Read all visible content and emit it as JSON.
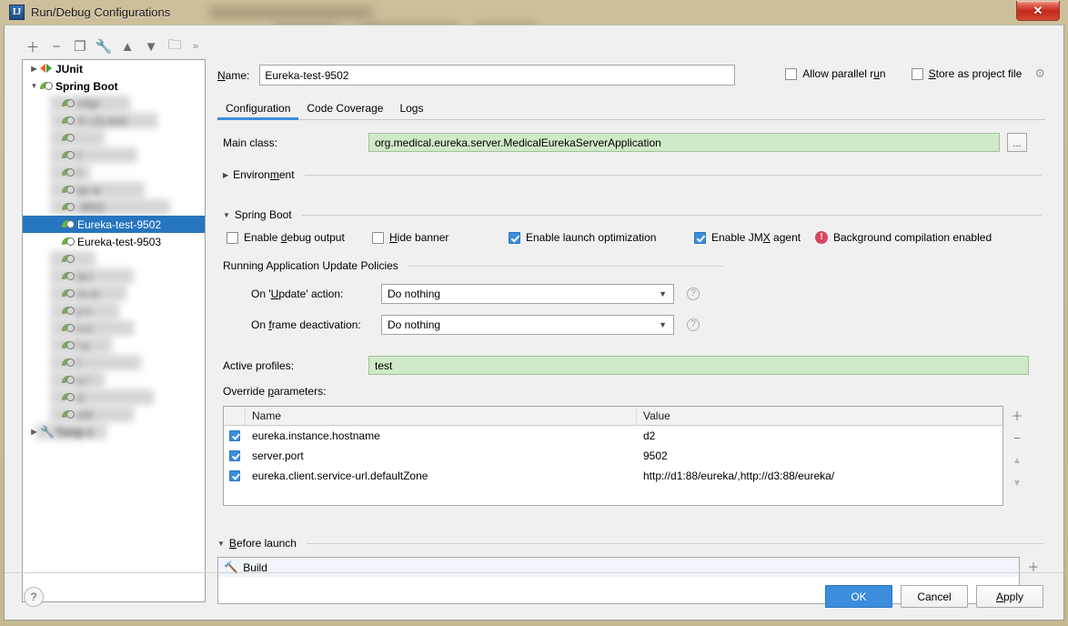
{
  "window": {
    "title": "Run/Debug Configurations",
    "app_icon": "intellij-idea-icon",
    "close_label": "✕"
  },
  "left_toolbar": {
    "buttons": [
      {
        "name": "add-configuration-button",
        "glyph": "＋"
      },
      {
        "name": "remove-configuration-button",
        "glyph": "−"
      },
      {
        "name": "copy-configuration-button",
        "glyph": "❐"
      },
      {
        "name": "edit-templates-button",
        "glyph": "🔧"
      },
      {
        "name": "move-up-button",
        "glyph": "▲"
      },
      {
        "name": "move-down-button",
        "glyph": "▼"
      },
      {
        "name": "move-into-folder-button",
        "glyph": "🗀"
      },
      {
        "name": "more-options-button",
        "glyph": "»"
      }
    ]
  },
  "tree": {
    "items": [
      {
        "label": "JUnit",
        "icon": "junit-icon",
        "level": 1,
        "twisty": "▶",
        "bold": true,
        "blurred": false,
        "selected": false
      },
      {
        "label": "Spring Boot",
        "icon": "spring-boot-icon",
        "level": 1,
        "twisty": "▼",
        "bold": true,
        "blurred": false,
        "selected": false
      },
      {
        "label": "nApi",
        "icon": "spring-boot-icon",
        "level": 2,
        "twisty": "",
        "bold": false,
        "blurred": true,
        "selected": false
      },
      {
        "label": "A      i (1)-test",
        "icon": "spring-boot-icon",
        "level": 2,
        "twisty": "",
        "bold": false,
        "blurred": true,
        "selected": false
      },
      {
        "label": "",
        "icon": "spring-boot-icon",
        "level": 2,
        "twisty": "",
        "bold": false,
        "blurred": true,
        "selected": false
      },
      {
        "label": "t",
        "icon": "spring-boot-icon",
        "level": 2,
        "twisty": "",
        "bold": false,
        "blurred": true,
        "selected": false
      },
      {
        "label": "r",
        "icon": "spring-boot-icon",
        "level": 2,
        "twisty": "",
        "bold": false,
        "blurred": true,
        "selected": false
      },
      {
        "label": "qu  w",
        "icon": "spring-boot-icon",
        "level": 2,
        "twisty": "",
        "bold": false,
        "blurred": true,
        "selected": false
      },
      {
        "label": "-9501",
        "icon": "spring-boot-icon",
        "level": 2,
        "twisty": "",
        "bold": false,
        "blurred": true,
        "selected": false
      },
      {
        "label": "Eureka-test-9502",
        "icon": "spring-boot-icon",
        "level": 2,
        "twisty": "",
        "bold": false,
        "blurred": false,
        "selected": true
      },
      {
        "label": "Eureka-test-9503",
        "icon": "spring-boot-icon",
        "level": 2,
        "twisty": "",
        "bold": false,
        "blurred": false,
        "selected": false
      },
      {
        "label": "",
        "icon": "spring-boot-icon",
        "level": 2,
        "twisty": "",
        "bold": false,
        "blurred": true,
        "selected": false
      },
      {
        "label": "la     t",
        "icon": "spring-boot-icon",
        "level": 2,
        "twisty": "",
        "bold": false,
        "blurred": true,
        "selected": false
      },
      {
        "label": "ro   ct",
        "icon": "spring-boot-icon",
        "level": 2,
        "twisty": "",
        "bold": false,
        "blurred": true,
        "selected": false
      },
      {
        "label": "y    v",
        "icon": "spring-boot-icon",
        "level": 2,
        "twisty": "",
        "bold": false,
        "blurred": true,
        "selected": false
      },
      {
        "label": "s    o",
        "icon": "spring-boot-icon",
        "level": 2,
        "twisty": "",
        "bold": false,
        "blurred": true,
        "selected": false
      },
      {
        "label": "l    a",
        "icon": "spring-boot-icon",
        "level": 2,
        "twisty": "",
        "bold": false,
        "blurred": true,
        "selected": false
      },
      {
        "label": "l",
        "icon": "spring-boot-icon",
        "level": 2,
        "twisty": "",
        "bold": false,
        "blurred": true,
        "selected": false
      },
      {
        "label": "u    /",
        "icon": "spring-boot-icon",
        "level": 2,
        "twisty": "",
        "bold": false,
        "blurred": true,
        "selected": false
      },
      {
        "label": "a",
        "icon": "spring-boot-icon",
        "level": 2,
        "twisty": "",
        "bold": false,
        "blurred": true,
        "selected": false
      },
      {
        "label": "ent",
        "icon": "spring-boot-icon",
        "level": 2,
        "twisty": "",
        "bold": false,
        "blurred": true,
        "selected": false
      },
      {
        "label": "Temp    s",
        "icon": "wrench-icon",
        "level": 1,
        "twisty": "▶",
        "bold": true,
        "blurred": true,
        "selected": false
      }
    ]
  },
  "header": {
    "name_label": "Name:",
    "name_value": "Eureka-test-9502",
    "allow_parallel_run_label": "Allow parallel run",
    "allow_parallel_run_checked": false,
    "store_as_project_file_label": "Store as project file",
    "store_as_project_file_checked": false,
    "gear_icon": "gear-icon"
  },
  "tabs": [
    {
      "label": "Configuration",
      "active": true
    },
    {
      "label": "Code Coverage",
      "active": false
    },
    {
      "label": "Logs",
      "active": false
    }
  ],
  "configuration": {
    "main_class_label": "Main class:",
    "main_class_value": "org.medical.eureka.server.MedicalEurekaServerApplication",
    "browse_button_label": "...",
    "environment_section": {
      "label": "Environment",
      "expanded": false,
      "twisty": "▶"
    },
    "spring_boot_section": {
      "label": "Spring Boot",
      "expanded": true,
      "twisty": "▼"
    },
    "spring_boot_checks": [
      {
        "label": "Enable debug output",
        "checked": false
      },
      {
        "label": "Hide banner",
        "checked": false
      },
      {
        "label": "Enable launch optimization",
        "checked": true
      },
      {
        "label": "Enable JMX agent",
        "checked": true
      }
    ],
    "background_compilation_warning": "Background compilation enabled",
    "update_policies_label": "Running Application Update Policies",
    "on_update_label": "On 'Update' action:",
    "on_update_value": "Do nothing",
    "on_frame_deactivation_label": "On frame deactivation:",
    "on_frame_deactivation_value": "Do nothing",
    "active_profiles_label": "Active profiles:",
    "active_profiles_value": "test",
    "override_parameters_label": "Override parameters:"
  },
  "param_table": {
    "columns": [
      "Name",
      "Value"
    ],
    "rows": [
      {
        "checked": true,
        "name": "eureka.instance.hostname",
        "value": "d2"
      },
      {
        "checked": true,
        "name": "server.port",
        "value": "9502"
      },
      {
        "checked": true,
        "name": "eureka.client.service-url.defaultZone",
        "value": "http://d1:88/eureka/,http://d3:88/eureka/"
      }
    ],
    "side_buttons": [
      {
        "name": "add-parameter-button",
        "glyph": "＋"
      },
      {
        "name": "remove-parameter-button",
        "glyph": "−"
      },
      {
        "name": "move-parameter-up-button",
        "glyph": "▲"
      },
      {
        "name": "move-parameter-down-button",
        "glyph": "▼"
      }
    ]
  },
  "before_launch": {
    "section_label": "Before launch",
    "twisty": "▼",
    "tasks": [
      {
        "label": "Build",
        "icon": "build-hammer-icon"
      }
    ],
    "add_button": "＋",
    "remove_button": "−"
  },
  "footer": {
    "help_label": "?",
    "ok_label": "OK",
    "cancel_label": "Cancel",
    "apply_label": "Apply"
  },
  "colors": {
    "accent": "#3c8ddc",
    "selection": "#2675bf",
    "green_field": "#cfeac6",
    "warning_red": "#d9455f",
    "spring_green": "#6db33f",
    "window_chrome": "#c9bb96"
  }
}
